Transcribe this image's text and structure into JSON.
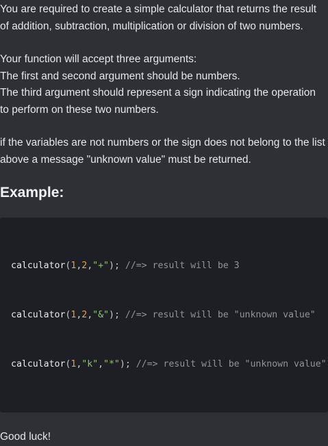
{
  "description": {
    "paragraph1": [
      "You are required to create a simple calculator that returns the result",
      "of addition, subtraction, multiplication or division of two numbers."
    ],
    "paragraph2": [
      "Your function will accept three arguments:",
      "The first and second argument should be numbers.",
      "The third argument should represent a sign indicating the operation",
      "to perform on these two numbers."
    ],
    "paragraph3": [
      "if the variables are not numbers or the sign does not belong to the list",
      "above a message \"unknown value\" must be returned."
    ]
  },
  "example": {
    "heading": "Example:",
    "code_lines": [
      {
        "fn": "calculator",
        "open": "(",
        "arg1": "1",
        "sep1": ",",
        "arg2": "2",
        "sep2": ",",
        "arg3": "\"+\"",
        "close": ");",
        "comment": "//=> result will be 3"
      },
      {
        "fn": "calculator",
        "open": "(",
        "arg1": "1",
        "sep1": ",",
        "arg2": "2",
        "sep2": ",",
        "arg3": "\"&\"",
        "close": ");",
        "comment": "//=> result will be \"unknown value\""
      },
      {
        "fn": "calculator",
        "open": "(",
        "arg1": "1",
        "sep1": ",",
        "arg2": "\"k\"",
        "sep2": ",",
        "arg3": "\"*\"",
        "close": ");",
        "comment": "//=> result will be \"unknown value\""
      }
    ]
  },
  "closing": "Good luck!",
  "colors": {
    "background": "#2f3036",
    "code_background": "#1e1f24",
    "text": "#e6e7eb",
    "number": "#e3a54d",
    "string": "#8fc36d",
    "comment": "#8f939c"
  }
}
